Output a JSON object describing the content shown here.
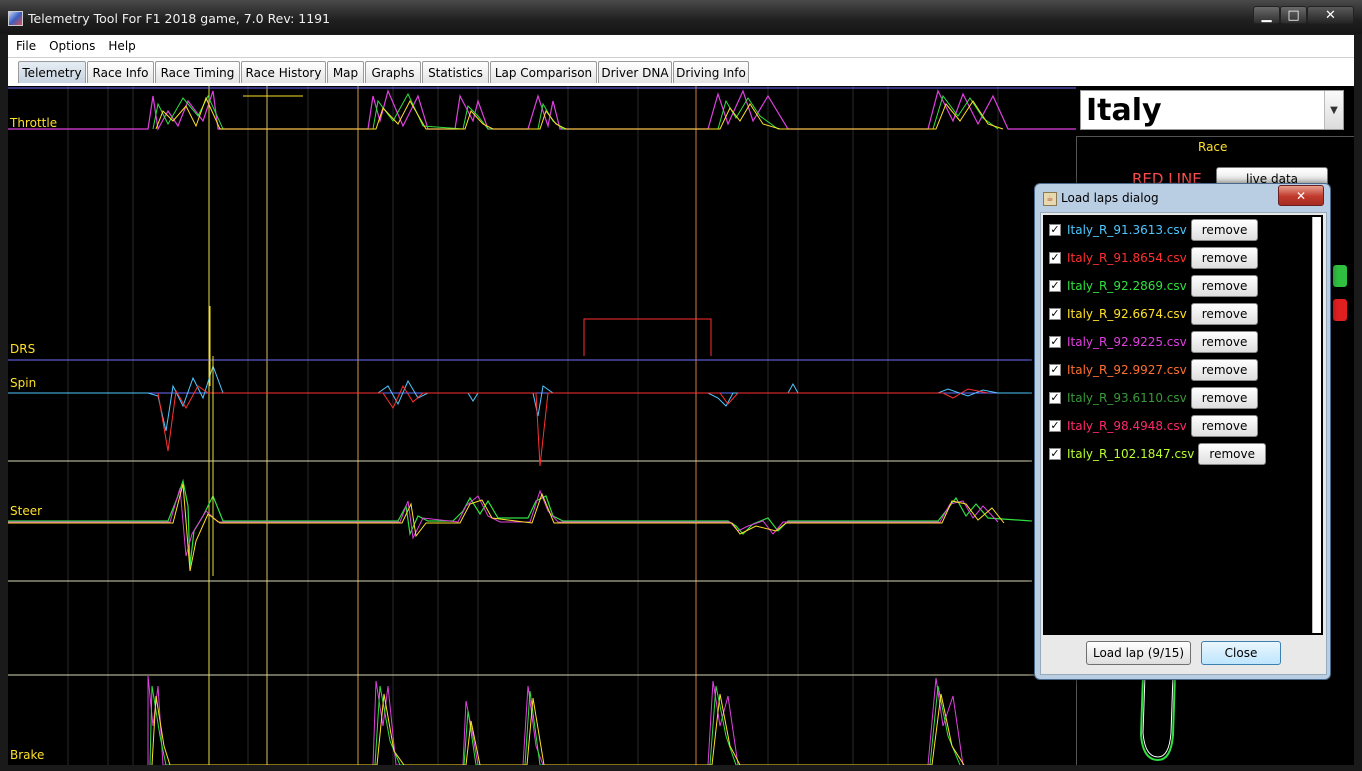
{
  "window": {
    "title": "Telemetry Tool For F1 2018 game, 7.0  Rev: 1191"
  },
  "menu": [
    "File",
    "Options",
    "Help"
  ],
  "tabs": [
    {
      "label": "Telemetry",
      "active": true
    },
    {
      "label": "Race Info"
    },
    {
      "label": "Race Timing"
    },
    {
      "label": "Race History"
    },
    {
      "label": "Map"
    },
    {
      "label": "Graphs"
    },
    {
      "label": "Statistics"
    },
    {
      "label": "Lap Comparison"
    },
    {
      "label": "Driver DNA"
    },
    {
      "label": "Driving Info"
    }
  ],
  "telemetry": {
    "labels": {
      "throttle": "Throttle",
      "drs": "DRS",
      "spin": "Spin",
      "steer": "Steer",
      "brake": "Brake"
    }
  },
  "side": {
    "track": "Italy",
    "session": "Race",
    "red_line": "RED LINE",
    "live_button": "live data"
  },
  "dialog": {
    "title": "Load laps dialog",
    "close_glyph": "✕",
    "laps": [
      {
        "name": "Italy_R_91.3613.csv",
        "color": "#4fc8ff",
        "checked": true
      },
      {
        "name": "Italy_R_91.8654.csv",
        "color": "#ff3030",
        "checked": true
      },
      {
        "name": "Italy_R_92.2869.csv",
        "color": "#30e040",
        "checked": true
      },
      {
        "name": "Italy_R_92.6674.csv",
        "color": "#ffe028",
        "checked": true
      },
      {
        "name": "Italy_R_92.9225.csv",
        "color": "#e040e0",
        "checked": true
      },
      {
        "name": "Italy_R_92.9927.csv",
        "color": "#ff7030",
        "checked": true
      },
      {
        "name": "Italy_R_93.6110.csv",
        "color": "#3a9a3a",
        "checked": true
      },
      {
        "name": "Italy_R_98.4948.csv",
        "color": "#ff2a6a",
        "checked": true
      },
      {
        "name": "Italy_R_102.1847.csv",
        "color": "#b8ff30",
        "checked": true
      }
    ],
    "remove_label": "remove",
    "load_button": "Load lap (9/15)",
    "close_button": "Close"
  }
}
